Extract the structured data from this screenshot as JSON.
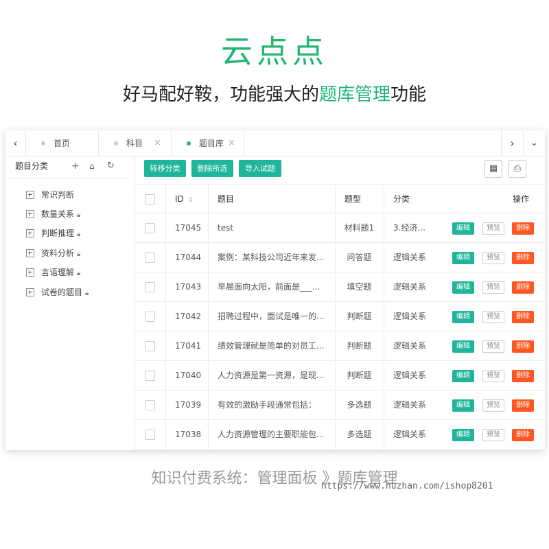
{
  "brand": {
    "logo_text": "云点点"
  },
  "headline": {
    "prefix": "好马配好鞍，功能强大的",
    "highlight": "题库管理",
    "suffix": "功能"
  },
  "tabs": [
    {
      "label": "首页",
      "active": false,
      "closable": false
    },
    {
      "label": "科目",
      "active": false,
      "closable": true
    },
    {
      "label": "题目库",
      "active": true,
      "closable": true
    }
  ],
  "sidebar": {
    "title": "题目分类",
    "items": [
      {
        "label": "常识判断",
        "locked": false
      },
      {
        "label": "数量关系",
        "locked": true
      },
      {
        "label": "判断推理",
        "locked": true
      },
      {
        "label": "资料分析",
        "locked": true
      },
      {
        "label": "言语理解",
        "locked": true
      },
      {
        "label": "试卷的题目",
        "locked": true
      }
    ]
  },
  "toolbar": {
    "move_category": "转移分类",
    "delete_selected": "删除所选",
    "import_questions": "导入试题"
  },
  "table": {
    "headers": {
      "id": "ID",
      "question": "题目",
      "type": "题型",
      "category": "分类",
      "actions": "操作"
    },
    "action_labels": {
      "edit": "编辑",
      "preview": "预览",
      "delete": "删除"
    },
    "rows": [
      {
        "id": "17045",
        "question": "test",
        "type": "材料题1",
        "category": "3.经济..."
      },
      {
        "id": "17044",
        "question": "案例：某科技公司近年来发...",
        "type": "问答题",
        "category": "逻辑关系"
      },
      {
        "id": "17043",
        "question": "早晨面向太阳，前面是___...",
        "type": "填空题",
        "category": "逻辑关系"
      },
      {
        "id": "17042",
        "question": "招聘过程中，面试是唯一的...",
        "type": "判断题",
        "category": "逻辑关系"
      },
      {
        "id": "17041",
        "question": "绩效管理就是简单的对员工...",
        "type": "判断题",
        "category": "逻辑关系"
      },
      {
        "id": "17040",
        "question": "人力资源是第一资源，是现...",
        "type": "判断题",
        "category": "逻辑关系"
      },
      {
        "id": "17039",
        "question": "有效的激励手段通常包括：",
        "type": "多选题",
        "category": "逻辑关系"
      },
      {
        "id": "17038",
        "question": "人力资源管理的主要职能包...",
        "type": "多选题",
        "category": "逻辑关系"
      }
    ]
  },
  "caption": "知识付费系统：管理面板 》题库管理",
  "watermark": "https://www.huzhan.com/ishop8201",
  "colors": {
    "brand_green": "#22b573",
    "button_teal": "#1fb59a",
    "delete_orange": "#ff5722"
  }
}
